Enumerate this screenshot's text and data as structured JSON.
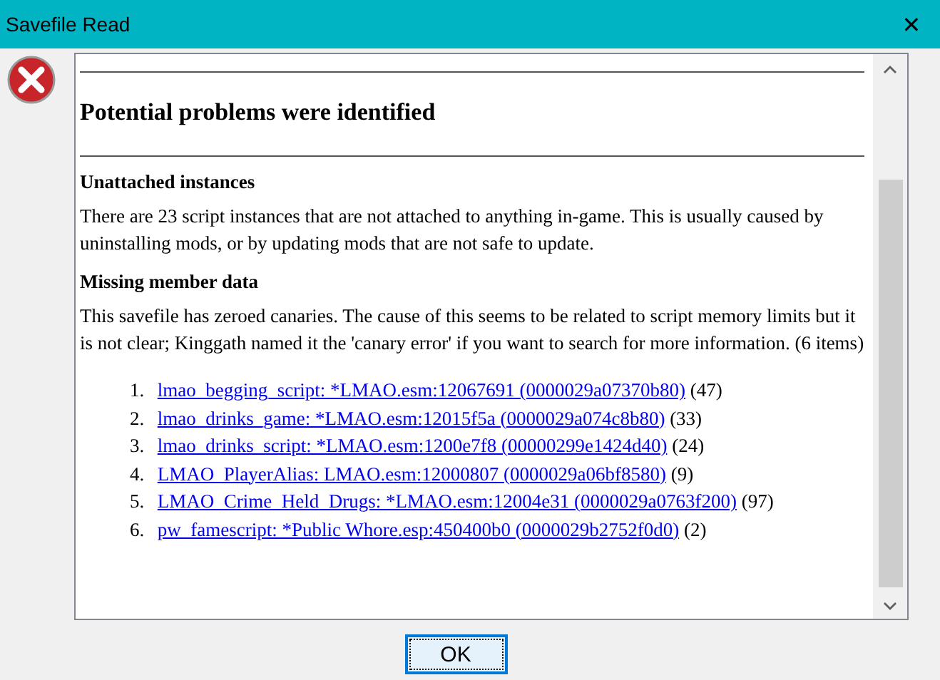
{
  "window": {
    "title": "Savefile Read",
    "close": "✕"
  },
  "heading": "Potential problems were identified",
  "sections": [
    {
      "title": "Unattached instances",
      "body": "There are 23 script instances that are not attached to anything in-game. This is usually caused by uninstalling mods, or by updating mods that are not safe to update."
    },
    {
      "title": "Missing member data",
      "body": "This savefile has zeroed canaries. The cause of this seems to be related to script memory limits but it is not clear; Kinggath named it the 'canary error' if you want to search for more information. (6 items)",
      "items": [
        {
          "number": "1.",
          "link": "lmao_begging_script: *LMAO.esm:12067691 (0000029a07370b80)",
          "count": "(47)"
        },
        {
          "number": "2.",
          "link": "lmao_drinks_game: *LMAO.esm:12015f5a (0000029a074c8b80)",
          "count": "(33)"
        },
        {
          "number": "3.",
          "link": "lmao_drinks_script: *LMAO.esm:1200e7f8 (00000299e1424d40)",
          "count": "(24)"
        },
        {
          "number": "4.",
          "link": "LMAO_PlayerAlias: LMAO.esm:12000807 (0000029a06bf8580)",
          "count": "(9)"
        },
        {
          "number": "5.",
          "link": "LMAO_Crime_Held_Drugs: *LMAO.esm:12004e31 (0000029a0763f200)",
          "count": "(97)"
        },
        {
          "number": "6.",
          "link": "pw_famescript: *Public Whore.esp:450400b0 (0000029b2752f0d0)",
          "count": "(2)"
        }
      ]
    }
  ],
  "buttons": [
    "OK"
  ]
}
